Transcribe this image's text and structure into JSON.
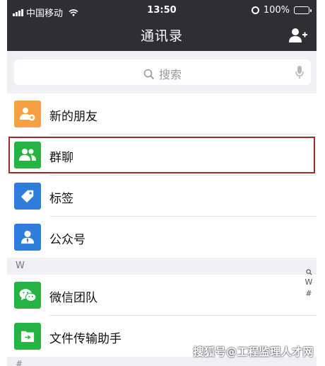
{
  "status_bar": {
    "carrier": "中国移动",
    "time": "13:50",
    "battery": "100%"
  },
  "nav": {
    "title": "通讯录"
  },
  "search": {
    "placeholder": "搜索"
  },
  "top_items": [
    {
      "label": "新的朋友",
      "icon": "new-friend-icon",
      "color": "#f5a043"
    },
    {
      "label": "群聊",
      "icon": "group-chat-icon",
      "color": "#27b343"
    },
    {
      "label": "标签",
      "icon": "tag-icon",
      "color": "#2f7ddb"
    },
    {
      "label": "公众号",
      "icon": "official-account-icon",
      "color": "#2f7ddb"
    }
  ],
  "sections": [
    {
      "header": "W",
      "items": [
        {
          "label": "微信团队",
          "icon": "wechat-team-icon",
          "color": "#27b343"
        },
        {
          "label": "文件传输助手",
          "icon": "file-transfer-icon",
          "color": "#27b343"
        }
      ]
    }
  ],
  "index_bar": [
    "W",
    "#"
  ],
  "bottom_partial_header": "#",
  "watermark": "搜狐号@工程监理人才网"
}
